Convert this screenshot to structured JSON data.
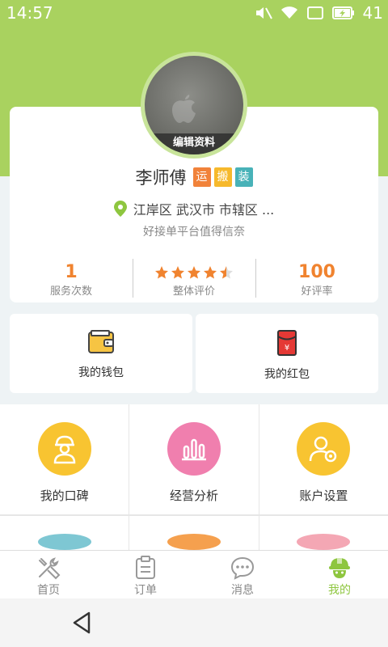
{
  "status_bar": {
    "time": "14:57",
    "battery": "41"
  },
  "profile": {
    "edit_label": "编辑资料",
    "name": "李师傅",
    "tags": [
      "运",
      "搬",
      "装"
    ],
    "location": "江岸区 武汉市 市辖区 ...",
    "slogan": "好接单平台值得信奈"
  },
  "stats": [
    {
      "value": "1",
      "label": "服务次数"
    },
    {
      "rating": 4.5,
      "label": "整体评价"
    },
    {
      "value": "100",
      "label": "好评率"
    }
  ],
  "wallet": [
    {
      "label": "我的钱包",
      "icon": "wallet-icon"
    },
    {
      "label": "我的红包",
      "icon": "red-envelope-icon"
    }
  ],
  "grid": [
    {
      "label": "我的口碑",
      "icon": "worker-icon",
      "color": "#f8c431"
    },
    {
      "label": "经营分析",
      "icon": "bar-chart-icon",
      "color": "#f07fae"
    },
    {
      "label": "账户设置",
      "icon": "user-settings-icon",
      "color": "#f8c431"
    }
  ],
  "grid_partial_colors": [
    "#7ec7d3",
    "#f5a04e",
    "#f4a7b4"
  ],
  "tabs": [
    {
      "label": "首页",
      "icon": "tools-icon",
      "active": false
    },
    {
      "label": "订单",
      "icon": "clipboard-icon",
      "active": false
    },
    {
      "label": "消息",
      "icon": "chat-icon",
      "active": false
    },
    {
      "label": "我的",
      "icon": "helmet-icon",
      "active": true
    }
  ],
  "colors": {
    "accent_green": "#a9d25f",
    "orange": "#f0832f",
    "tab_active": "#8ec63f"
  }
}
